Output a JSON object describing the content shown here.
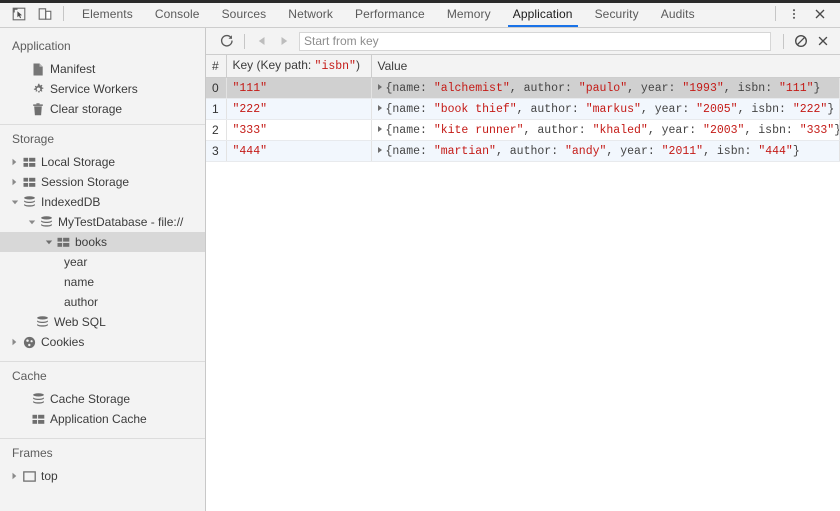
{
  "window": {
    "devtools_icons": [
      {
        "name": "inspect-element-icon",
        "label": "Inspect element"
      },
      {
        "name": "device-toolbar-icon",
        "label": "Toggle device toolbar"
      }
    ],
    "tabs": [
      {
        "label": "Elements",
        "active": false
      },
      {
        "label": "Console",
        "active": false
      },
      {
        "label": "Sources",
        "active": false
      },
      {
        "label": "Network",
        "active": false
      },
      {
        "label": "Performance",
        "active": false
      },
      {
        "label": "Memory",
        "active": false
      },
      {
        "label": "Application",
        "active": true
      },
      {
        "label": "Security",
        "active": false
      },
      {
        "label": "Audits",
        "active": false
      }
    ],
    "right_icons": [
      {
        "name": "more-options-icon",
        "label": "Customize and control DevTools"
      },
      {
        "name": "close-devtools-icon",
        "label": "Close"
      }
    ],
    "accent_color": "#1a73e8"
  },
  "sidebar": {
    "sections": [
      {
        "title": "Application",
        "items": [
          {
            "label": "Manifest",
            "icon": "manifest-file-icon",
            "indent": 1,
            "twisty": "none",
            "selected": false
          },
          {
            "label": "Service Workers",
            "icon": "gear-icon",
            "indent": 1,
            "twisty": "none",
            "selected": false
          },
          {
            "label": "Clear storage",
            "icon": "trash-icon",
            "indent": 1,
            "twisty": "none",
            "selected": false
          }
        ]
      },
      {
        "title": "Storage",
        "items": [
          {
            "label": "Local Storage",
            "icon": "table-icon",
            "indent": 1,
            "twisty": "collapsed",
            "selected": false
          },
          {
            "label": "Session Storage",
            "icon": "table-icon",
            "indent": 1,
            "twisty": "collapsed",
            "selected": false
          },
          {
            "label": "IndexedDB",
            "icon": "database-icon",
            "indent": 1,
            "twisty": "expanded",
            "selected": false
          },
          {
            "label": "MyTestDatabase - file://",
            "icon": "database-icon",
            "indent": 2,
            "twisty": "expanded",
            "selected": false
          },
          {
            "label": "books",
            "icon": "table-icon",
            "indent": 3,
            "twisty": "expanded",
            "selected": true
          },
          {
            "label": "year",
            "icon": "none",
            "indent": 4,
            "twisty": "none",
            "selected": false
          },
          {
            "label": "name",
            "icon": "none",
            "indent": 4,
            "twisty": "none",
            "selected": false
          },
          {
            "label": "author",
            "icon": "none",
            "indent": 4,
            "twisty": "none",
            "selected": false
          },
          {
            "label": "Web SQL",
            "icon": "database-icon",
            "indent": 2,
            "twisty": "none",
            "selected": false
          },
          {
            "label": "Cookies",
            "icon": "cookie-icon",
            "indent": 1,
            "twisty": "collapsed",
            "selected": false
          }
        ]
      },
      {
        "title": "Cache",
        "items": [
          {
            "label": "Cache Storage",
            "icon": "database-icon",
            "indent": 1,
            "twisty": "none",
            "selected": false
          },
          {
            "label": "Application Cache",
            "icon": "table-icon",
            "indent": 1,
            "twisty": "none",
            "selected": false
          }
        ]
      },
      {
        "title": "Frames",
        "items": [
          {
            "label": "top",
            "icon": "frame-icon",
            "indent": 1,
            "twisty": "collapsed",
            "selected": false
          }
        ]
      }
    ]
  },
  "toolbar": {
    "refresh_label": "Refresh",
    "prev_label": "Show previous page",
    "next_label": "Show next page",
    "search_placeholder": "Start from key",
    "search_value": "",
    "clear_label": "Clear object store",
    "delete_label": "Delete selected"
  },
  "grid": {
    "columns": [
      {
        "id": "index",
        "label": "#"
      },
      {
        "id": "key",
        "label": "Key (Key path: ",
        "keypath": "\"isbn\"",
        "label_end": ")"
      },
      {
        "id": "value",
        "label": "Value"
      }
    ],
    "rows": [
      {
        "index": "0",
        "key": "\"111\"",
        "selected": true,
        "value_fields": [
          {
            "k": "name",
            "v": "\"alchemist\""
          },
          {
            "k": "author",
            "v": "\"paulo\""
          },
          {
            "k": "year",
            "v": "\"1993\""
          },
          {
            "k": "isbn",
            "v": "\"111\""
          }
        ]
      },
      {
        "index": "1",
        "key": "\"222\"",
        "selected": false,
        "value_fields": [
          {
            "k": "name",
            "v": "\"book thief\""
          },
          {
            "k": "author",
            "v": "\"markus\""
          },
          {
            "k": "year",
            "v": "\"2005\""
          },
          {
            "k": "isbn",
            "v": "\"222\""
          }
        ]
      },
      {
        "index": "2",
        "key": "\"333\"",
        "selected": false,
        "value_fields": [
          {
            "k": "name",
            "v": "\"kite runner\""
          },
          {
            "k": "author",
            "v": "\"khaled\""
          },
          {
            "k": "year",
            "v": "\"2003\""
          },
          {
            "k": "isbn",
            "v": "\"333\""
          }
        ]
      },
      {
        "index": "3",
        "key": "\"444\"",
        "selected": false,
        "value_fields": [
          {
            "k": "name",
            "v": "\"martian\""
          },
          {
            "k": "author",
            "v": "\"andy\""
          },
          {
            "k": "year",
            "v": "\"2011\""
          },
          {
            "k": "isbn",
            "v": "\"444\""
          }
        ]
      }
    ]
  },
  "colors": {
    "string_value": "#c41a16",
    "selected_row": "#d0d0d0",
    "alt_row": "#f2f7fd",
    "sidebar_bg": "#f3f3f3",
    "sidebar_selected": "#d8d8d8"
  }
}
